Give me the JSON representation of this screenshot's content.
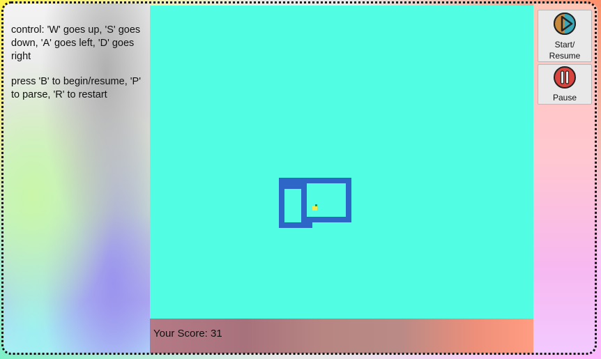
{
  "instructions": {
    "controls": "control: 'W' goes up, 'S' goes down, 'A' goes left, 'D' goes right",
    "keys": "press 'B' to begin/resume, 'P' to parse, 'R' to restart"
  },
  "score": {
    "text": "Your Score: 31"
  },
  "buttons": {
    "start_label_line1": "Start/",
    "start_label_line2": "Resume",
    "start_icon": "play-icon",
    "pause_label": "Pause",
    "pause_icon": "pause-icon"
  },
  "game": {
    "grid_cell": 8,
    "board_color": "#51fde3",
    "snake_color": "#2e66c8",
    "food_color": "#f1ea4a",
    "snake_cells": [
      [
        31,
        30
      ],
      [
        32,
        30
      ],
      [
        33,
        30
      ],
      [
        34,
        30
      ],
      [
        35,
        30
      ],
      [
        36,
        30
      ],
      [
        37,
        30
      ],
      [
        38,
        30
      ],
      [
        39,
        30
      ],
      [
        40,
        30
      ],
      [
        41,
        30
      ],
      [
        42,
        30
      ],
      [
        43,
        30
      ],
      [
        43,
        31
      ],
      [
        43,
        32
      ],
      [
        43,
        33
      ],
      [
        43,
        34
      ],
      [
        43,
        35
      ],
      [
        43,
        36
      ],
      [
        43,
        37
      ],
      [
        42,
        37
      ],
      [
        41,
        37
      ],
      [
        40,
        37
      ],
      [
        39,
        37
      ],
      [
        38,
        37
      ],
      [
        37,
        37
      ],
      [
        36,
        37
      ],
      [
        35,
        37
      ],
      [
        35,
        36
      ],
      [
        35,
        35
      ],
      [
        35,
        34
      ],
      [
        35,
        33
      ],
      [
        35,
        32
      ],
      [
        35,
        31
      ],
      [
        34,
        31
      ],
      [
        33,
        31
      ],
      [
        32,
        31
      ],
      [
        31,
        31
      ],
      [
        31,
        32
      ],
      [
        31,
        33
      ],
      [
        31,
        34
      ],
      [
        31,
        35
      ],
      [
        31,
        36
      ],
      [
        31,
        37
      ],
      [
        31,
        38
      ],
      [
        32,
        38
      ],
      [
        33,
        38
      ],
      [
        34,
        38
      ],
      [
        35,
        38
      ],
      [
        36,
        38
      ]
    ],
    "food_cell": [
      37,
      35
    ]
  },
  "colors": {
    "button_bg": "#e9e9e9",
    "start_icon_fill": "#c98a3c",
    "start_icon_accent": "#3aa7b8",
    "pause_icon_fill": "#d9443e"
  }
}
